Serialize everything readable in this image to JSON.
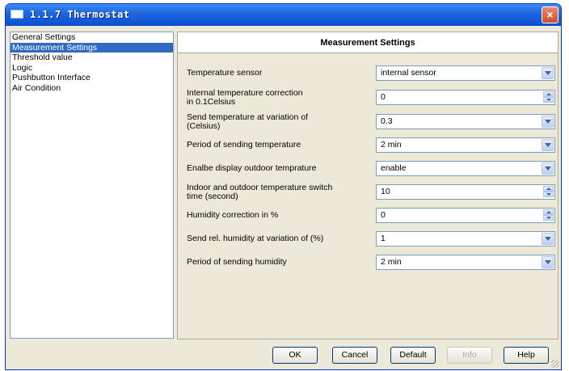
{
  "window": {
    "title": "1.1.7 Thermostat",
    "close_label": "×"
  },
  "sidebar": {
    "items": [
      {
        "label": "General Settings",
        "selected": false
      },
      {
        "label": "Measurement Settings",
        "selected": true
      },
      {
        "label": "Threshold value",
        "selected": false
      },
      {
        "label": "Logic",
        "selected": false
      },
      {
        "label": "Pushbutton Interface",
        "selected": false
      },
      {
        "label": "Air Condition",
        "selected": false
      }
    ]
  },
  "main": {
    "header": "Measurement Settings",
    "rows": [
      {
        "label": "Temperature sensor",
        "value": "internal sensor",
        "control": "dropdown"
      },
      {
        "label": "Internal temperature correction\nin 0.1Celsius",
        "value": "0",
        "control": "spinner"
      },
      {
        "label": "Send temperature at variation of\n(Celsius)",
        "value": "0.3",
        "control": "dropdown"
      },
      {
        "label": "Period of sending temperature",
        "value": "2 min",
        "control": "dropdown"
      },
      {
        "label": "Enalbe display outdoor temprature",
        "value": "enable",
        "control": "dropdown"
      },
      {
        "label": "Indoor and outdoor temperature switch\ntime (second)",
        "value": "10",
        "control": "spinner"
      },
      {
        "label": "Humidity correction in %",
        "value": "0",
        "control": "spinner"
      },
      {
        "label": "Send rel. humidity at variation of (%)",
        "value": "1",
        "control": "dropdown"
      },
      {
        "label": "Period of sending  humidity",
        "value": "2 min",
        "control": "dropdown"
      }
    ]
  },
  "footer": {
    "ok": "OK",
    "cancel": "Cancel",
    "default": "Default",
    "info": "Info",
    "help": "Help"
  },
  "colors": {
    "title_bar": "#0b4fd1",
    "selection": "#316ac5",
    "panel": "#ece9d8"
  }
}
